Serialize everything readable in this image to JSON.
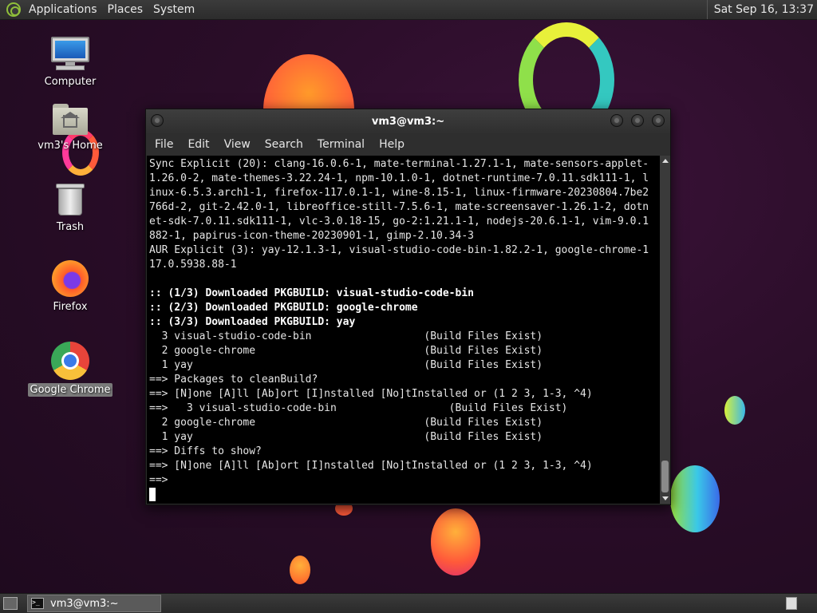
{
  "top_panel": {
    "menus": [
      "Applications",
      "Places",
      "System"
    ],
    "clock": "Sat Sep 16, 13:37"
  },
  "desktop": {
    "icons": [
      {
        "label": "Computer",
        "icon": "computer-icon"
      },
      {
        "label": "vm3's Home",
        "icon": "home-folder-icon"
      },
      {
        "label": "Trash",
        "icon": "trash-icon"
      },
      {
        "label": "Firefox",
        "icon": "firefox-icon"
      },
      {
        "label": "Google Chrome",
        "icon": "chrome-icon"
      }
    ]
  },
  "terminal": {
    "title": "vm3@vm3:~",
    "menus": [
      "File",
      "Edit",
      "View",
      "Search",
      "Terminal",
      "Help"
    ],
    "lines": [
      {
        "text": "Sync Explicit (20): clang-16.0.6-1, mate-terminal-1.27.1-1, mate-sensors-applet-",
        "bold": false
      },
      {
        "text": "1.26.0-2, mate-themes-3.22.24-1, npm-10.1.0-1, dotnet-runtime-7.0.11.sdk111-1, l",
        "bold": false
      },
      {
        "text": "inux-6.5.3.arch1-1, firefox-117.0.1-1, wine-8.15-1, linux-firmware-20230804.7be2",
        "bold": false
      },
      {
        "text": "766d-2, git-2.42.0-1, libreoffice-still-7.5.6-1, mate-screensaver-1.26.1-2, dotn",
        "bold": false
      },
      {
        "text": "et-sdk-7.0.11.sdk111-1, vlc-3.0.18-15, go-2:1.21.1-1, nodejs-20.6.1-1, vim-9.0.1",
        "bold": false
      },
      {
        "text": "882-1, papirus-icon-theme-20230901-1, gimp-2.10.34-3",
        "bold": false
      },
      {
        "text": "AUR Explicit (3): yay-12.1.3-1, visual-studio-code-bin-1.82.2-1, google-chrome-1",
        "bold": false
      },
      {
        "text": "17.0.5938.88-1",
        "bold": false
      },
      {
        "text": "",
        "bold": false
      },
      {
        "text": ":: (1/3) Downloaded PKGBUILD: visual-studio-code-bin",
        "bold": true
      },
      {
        "text": ":: (2/3) Downloaded PKGBUILD: google-chrome",
        "bold": true
      },
      {
        "text": ":: (3/3) Downloaded PKGBUILD: yay",
        "bold": true
      },
      {
        "text": "  3 visual-studio-code-bin                  (Build Files Exist)",
        "bold": false
      },
      {
        "text": "  2 google-chrome                           (Build Files Exist)",
        "bold": false
      },
      {
        "text": "  1 yay                                     (Build Files Exist)",
        "bold": false
      },
      {
        "text": "==> Packages to cleanBuild?",
        "bold": false
      },
      {
        "text": "==> [N]one [A]ll [Ab]ort [I]nstalled [No]tInstalled or (1 2 3, 1-3, ^4)",
        "bold": false
      },
      {
        "text": "==>   3 visual-studio-code-bin                  (Build Files Exist)",
        "bold": false
      },
      {
        "text": "  2 google-chrome                           (Build Files Exist)",
        "bold": false
      },
      {
        "text": "  1 yay                                     (Build Files Exist)",
        "bold": false
      },
      {
        "text": "==> Diffs to show?",
        "bold": false
      },
      {
        "text": "==> [N]one [A]ll [Ab]ort [I]nstalled [No]tInstalled or (1 2 3, 1-3, ^4)",
        "bold": false
      },
      {
        "text": "==>",
        "bold": false
      }
    ]
  },
  "taskbar": {
    "window_label": "vm3@vm3:~"
  },
  "colors": {
    "terminal_bg": "#000000",
    "panel_bg": "#333333",
    "terminal_text": "#e6e6e6"
  }
}
